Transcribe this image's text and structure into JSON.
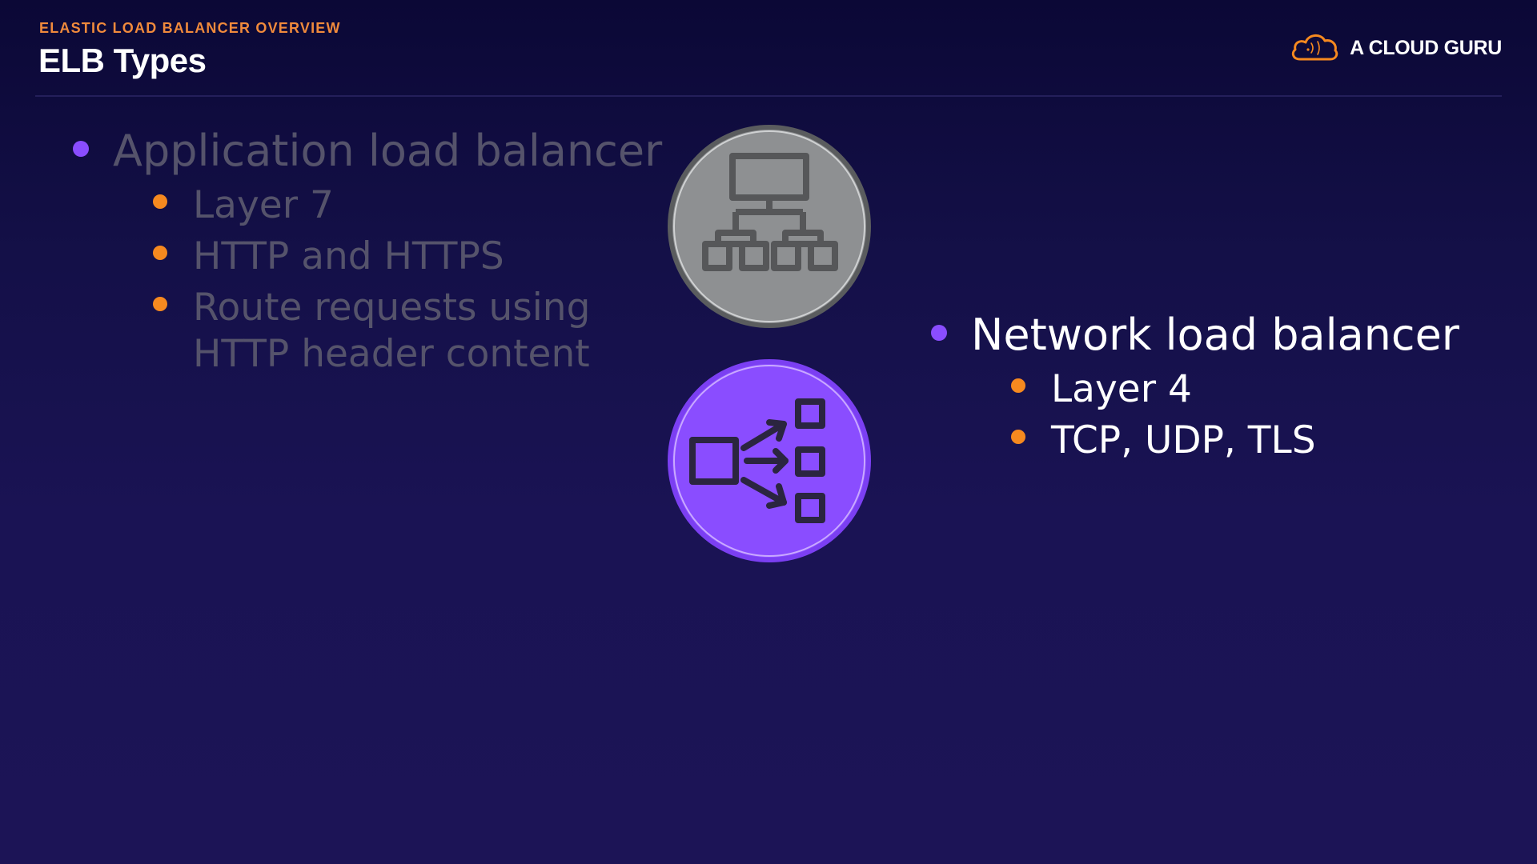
{
  "header": {
    "kicker": "ELASTIC LOAD BALANCER OVERVIEW",
    "title": "ELB Types",
    "brand": "A CLOUD GURU",
    "brand_icon": "cloud-logo-icon"
  },
  "left": {
    "heading": "Application load balancer",
    "points": [
      "Layer 7",
      "HTTP and HTTPS",
      "Route requests using HTTP header content"
    ],
    "icon": "application-load-balancer-icon",
    "state": "dimmed"
  },
  "right": {
    "heading": "Network load balancer",
    "points": [
      "Layer 4",
      "TCP, UDP, TLS"
    ],
    "icon": "network-load-balancer-icon",
    "state": "highlighted"
  },
  "colors": {
    "accent_orange": "#f6891f",
    "accent_purple": "#8a4dff",
    "dim_text": "#55536b",
    "icon_gray": "#8e9092"
  }
}
